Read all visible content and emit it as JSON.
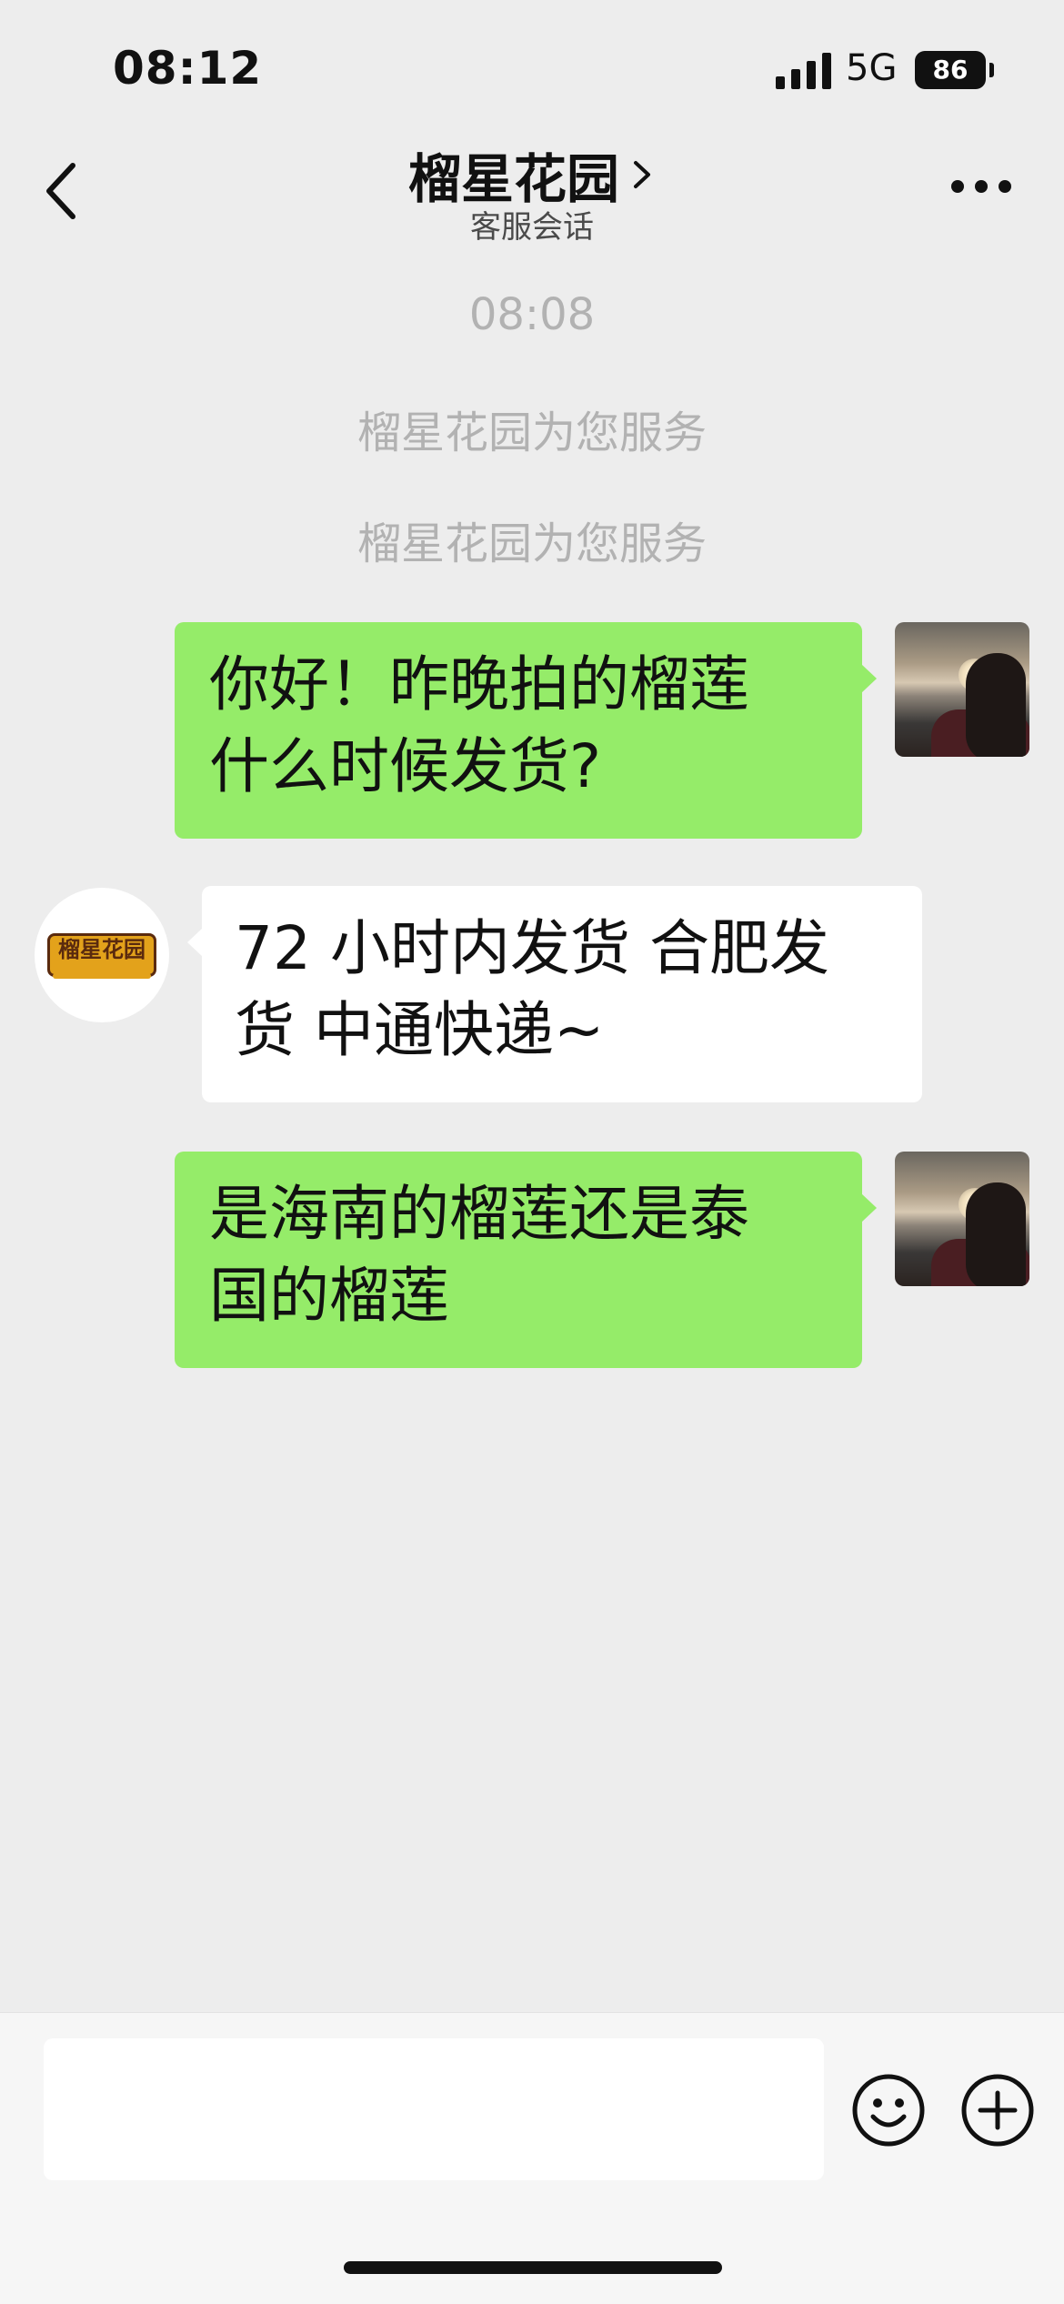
{
  "status_bar": {
    "time": "08:12",
    "network": "5G",
    "battery": "86"
  },
  "header": {
    "title": "榴星花园",
    "subtitle": "客服会话"
  },
  "system_messages": {
    "timestamp": "08:08",
    "service_notice_1": "榴星花园为您服务",
    "service_notice_2": "榴星花园为您服务"
  },
  "messages": [
    {
      "sender": "me",
      "lines": [
        "你好！昨晚拍的榴莲",
        "什么时候发货?"
      ]
    },
    {
      "sender": "shop",
      "lines": [
        "72 小时内发货 合肥发",
        "货 中通快递~"
      ]
    },
    {
      "sender": "me",
      "lines": [
        "是海南的榴莲还是泰",
        "国的榴莲"
      ]
    }
  ],
  "shop_avatar": {
    "logo_text": "榴星花园"
  },
  "input_bar": {
    "value": "",
    "emoji_icon": "smiley-icon",
    "plus_icon": "plus-circle-icon"
  },
  "colors": {
    "background": "#ededed",
    "outgoing_bubble": "#95ec69",
    "incoming_bubble": "#ffffff",
    "system_text": "#b2b2b2"
  }
}
